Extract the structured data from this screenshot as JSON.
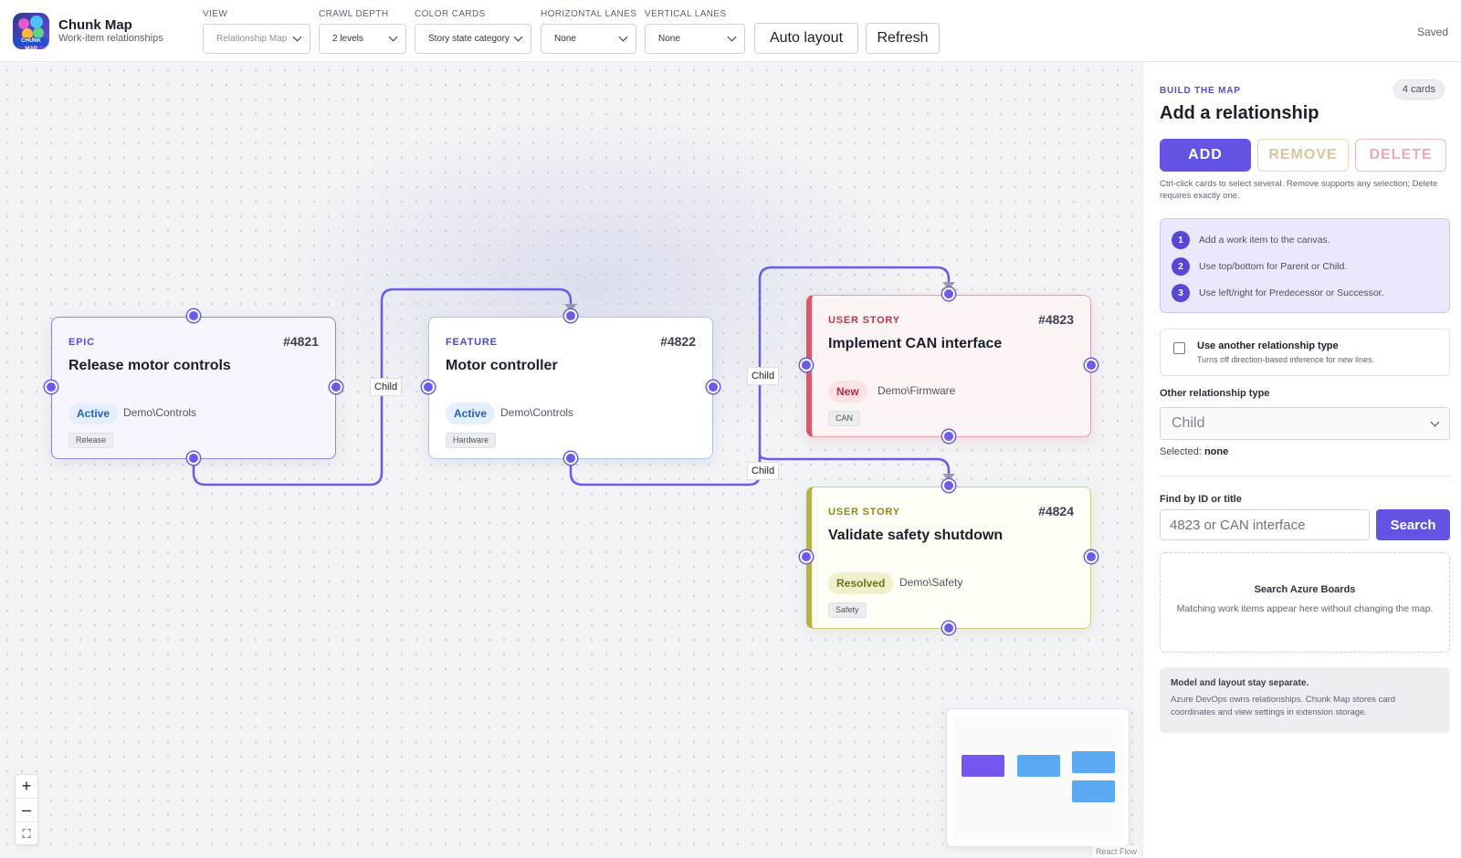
{
  "app": {
    "title": "Chunk Map",
    "subtitle": "Work-item relationships",
    "status": "Saved"
  },
  "toolbar": {
    "view": {
      "label": "VIEW",
      "value": "Relationship Map"
    },
    "crawl_depth": {
      "label": "CRAWL DEPTH",
      "value": "2 levels"
    },
    "color_cards": {
      "label": "COLOR CARDS",
      "value": "Story state category"
    },
    "horizontal_lanes": {
      "label": "HORIZONTAL LANES",
      "value": "None"
    },
    "vertical_lanes": {
      "label": "VERTICAL LANES",
      "value": "None"
    },
    "auto_layout_label": "Auto layout",
    "refresh_label": "Refresh"
  },
  "cards": [
    {
      "type": "EPIC",
      "id": "#4821",
      "title": "Release motor controls",
      "state": "Active",
      "area": "Demo\\Controls",
      "tag": "Release"
    },
    {
      "type": "FEATURE",
      "id": "#4822",
      "title": "Motor controller",
      "state": "Active",
      "area": "Demo\\Controls",
      "tag": "Hardware"
    },
    {
      "type": "USER STORY",
      "id": "#4823",
      "title": "Implement CAN interface",
      "state": "New",
      "area": "Demo\\Firmware",
      "tag": "CAN"
    },
    {
      "type": "USER STORY",
      "id": "#4824",
      "title": "Validate safety shutdown",
      "state": "Resolved",
      "area": "Demo\\Safety",
      "tag": "Safety"
    }
  ],
  "edges": [
    {
      "label": "Child"
    },
    {
      "label": "Child"
    },
    {
      "label": "Child"
    }
  ],
  "colors": {
    "accent": "#6452e3",
    "edge": "#6a5ce8",
    "new": "#e0556a",
    "resolved": "#b6b43f",
    "active": "#2560b8"
  },
  "zoom_controls": {
    "zoom_in": "+",
    "zoom_out": "–",
    "fit": "⛶"
  },
  "minimap": {
    "attribution": "React Flow"
  },
  "sidebar": {
    "kicker": "BUILD THE MAP",
    "card_count": "4 cards",
    "title": "Add a relationship",
    "add_label": "ADD",
    "remove_label": "REMOVE",
    "delete_label": "DELETE",
    "hint": "Ctrl-click cards to select several. Remove supports any selection; Delete requires exactly one.",
    "steps": [
      {
        "num": "1",
        "text": "Add a work item to the canvas."
      },
      {
        "num": "2",
        "text": "Use top/bottom for Parent or Child."
      },
      {
        "num": "3",
        "text": "Use left/right for Predecessor or Successor."
      }
    ],
    "other_type_toggle": {
      "label": "Use another relationship type",
      "desc": "Turns off direction-based inference for new lines."
    },
    "other_type_label": "Other relationship type",
    "other_type_value": "Child",
    "selected_label": "Selected:",
    "selected_value": "none",
    "find_label": "Find by ID or title",
    "find_placeholder": "4823 or CAN interface",
    "search_label": "Search",
    "results_title": "Search Azure Boards",
    "results_desc": "Matching work items appear here without changing the map.",
    "note_title": "Model and layout stay separate.",
    "note_desc": "Azure DevOps owns relationships. Chunk Map stores card coordinates and view settings in extension storage."
  }
}
